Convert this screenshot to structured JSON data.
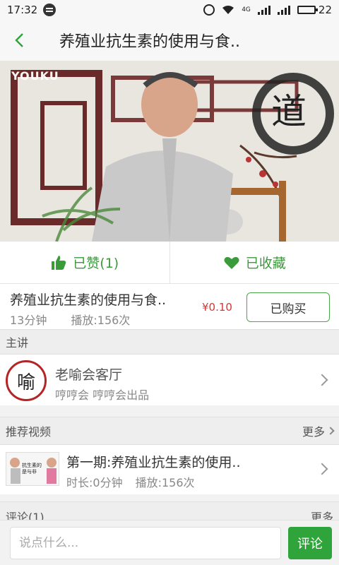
{
  "status_bar": {
    "time": "17:32",
    "network_label": "4G",
    "battery": "22"
  },
  "header": {
    "back_icon": "chevron-left-icon",
    "title": "养殖业抗生素的使用与食.."
  },
  "video": {
    "watermark": "YOUKU",
    "calligraphy": "道"
  },
  "actions": {
    "like_label": "已赞(1)",
    "collect_label": "已收藏",
    "accent_color": "#3a9b3a"
  },
  "course": {
    "title": "养殖业抗生素的使用与食..",
    "duration": "13分钟",
    "plays": "播放:156次",
    "price": "¥0.10",
    "buy_label": "已购买"
  },
  "sections": {
    "lecturer_header": "主讲",
    "recommend_header": "推荐视频",
    "recommend_more": "更多",
    "comments_header": "评论(1)",
    "comments_more": "更多"
  },
  "lecturer": {
    "avatar_text": "喻",
    "name": "老喻会客厅",
    "subtitle": "哼哼会 哼哼会出品"
  },
  "recommended": [
    {
      "thumb_text": "抗生素的是与非",
      "title": "第一期:养殖业抗生素的使用..",
      "duration": "时长:0分钟",
      "plays": "播放:156次"
    }
  ],
  "comment_bar": {
    "placeholder": "说点什么...",
    "submit_label": "评论",
    "submit_color": "#2ea43a"
  }
}
